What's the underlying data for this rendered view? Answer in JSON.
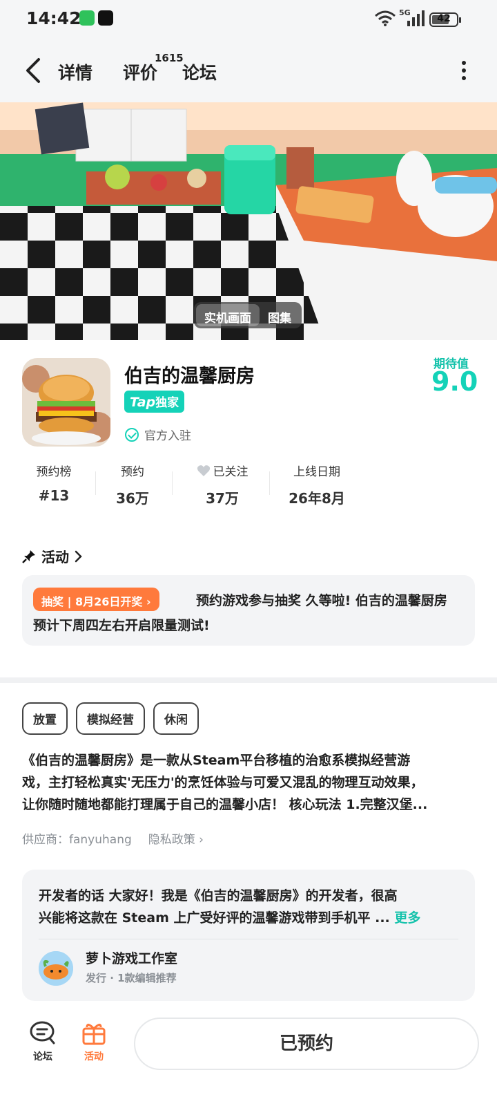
{
  "status_bar": {
    "time": "14:42",
    "network": "5G",
    "battery": "42"
  },
  "nav": {
    "tabs": [
      {
        "label": "详情"
      },
      {
        "label": "评价"
      },
      {
        "label": "论坛"
      }
    ],
    "review_count": "1615"
  },
  "hero": {
    "toggle": [
      "实机画面",
      "图集"
    ]
  },
  "game": {
    "title": "伯吉的温馨厨房",
    "badge_tap": "Tap",
    "badge_text": "独家",
    "official": "官方入驻",
    "rating_label": "期待值",
    "rating_value": "9.0"
  },
  "stats": [
    {
      "label": "预约榜",
      "value": "#13"
    },
    {
      "label": "预约",
      "value": "36万"
    },
    {
      "label": "已关注",
      "value": "37万"
    },
    {
      "label": "上线日期",
      "value": "26年8月"
    }
  ],
  "activity": {
    "heading": "活动",
    "pill": "抽奖 | 8月26日开奖",
    "line1": "预约游戏参与抽奖 久等啦! 伯吉的温馨厨房",
    "line2": "预计下周四左右开启限量测试!"
  },
  "tags": [
    "放置",
    "模拟经营",
    "休闲"
  ],
  "description": [
    "《伯吉的温馨厨房》是一款从Steam平台移植的治愈系模拟经营游",
    "戏，主打轻松真实'无压力'的烹饪体验与可爱又混乱的物理互动效果，",
    "让你随时随地都能打理属于自己的温馨小店！ 核心玩法 1.完整汉堡..."
  ],
  "supplier": {
    "label": "供应商：fanyuhang",
    "privacy": "隐私政策"
  },
  "developer": {
    "line1": "开发者的话  大家好！我是《伯吉的温馨厨房》的开发者，很高",
    "line2": "兴能将这款在 Steam 上广受好评的温馨游戏带到手机平 ...",
    "more": "更多",
    "name": "萝卜游戏工作室",
    "sub": "发行 · 1款编辑推荐"
  },
  "bottom_bar": {
    "forum": "论坛",
    "activity": "活动",
    "reserve": "已预约"
  },
  "colors": {
    "accent": "#14d2b8",
    "orange": "#ff7a3c"
  }
}
